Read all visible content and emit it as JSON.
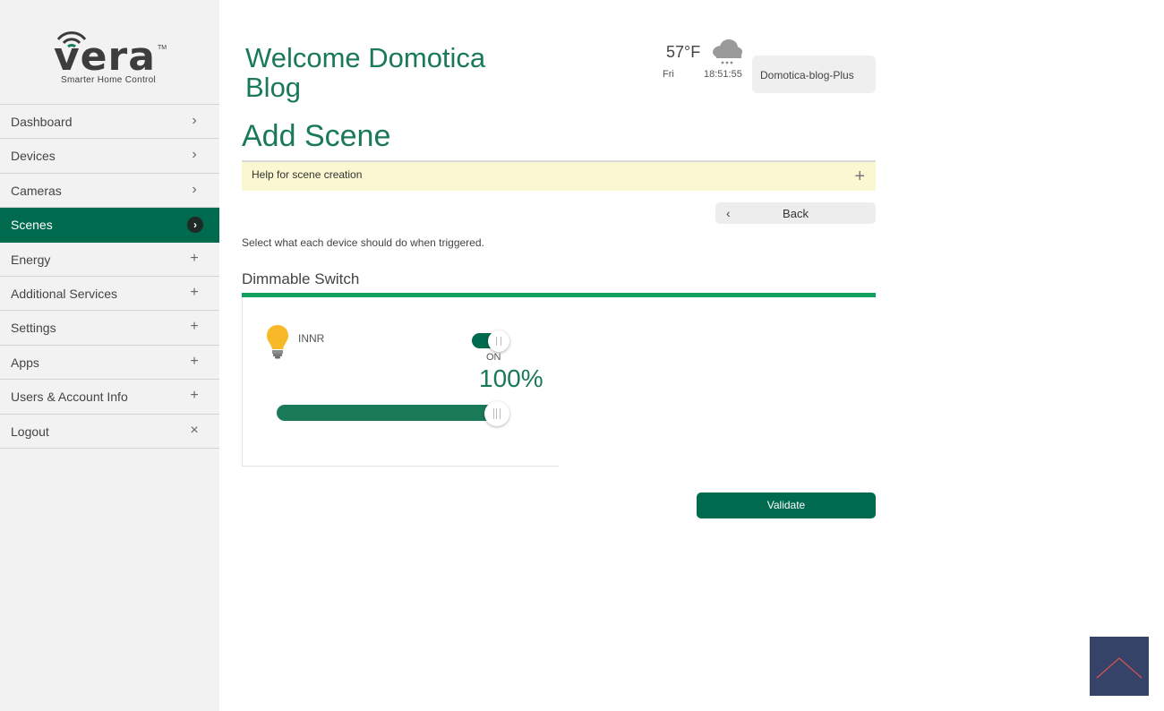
{
  "brand": {
    "logo_text": "vera",
    "tagline": "Smarter Home Control",
    "trademark": "TM"
  },
  "sidebar": {
    "items": [
      {
        "label": "Dashboard",
        "icon": "chevron-right-icon",
        "glyph": "›",
        "active": false
      },
      {
        "label": "Devices",
        "icon": "chevron-right-icon",
        "glyph": "›",
        "active": false
      },
      {
        "label": "Cameras",
        "icon": "chevron-right-icon",
        "glyph": "›",
        "active": false
      },
      {
        "label": "Scenes",
        "icon": "chevron-right-circle-icon",
        "glyph": "›",
        "active": true
      },
      {
        "label": "Energy",
        "icon": "plus-icon",
        "glyph": "+",
        "active": false
      },
      {
        "label": "Additional Services",
        "icon": "plus-icon",
        "glyph": "+",
        "active": false
      },
      {
        "label": "Settings",
        "icon": "plus-icon",
        "glyph": "+",
        "active": false
      },
      {
        "label": "Apps",
        "icon": "plus-icon",
        "glyph": "+",
        "active": false
      },
      {
        "label": "Users & Account Info",
        "icon": "plus-icon",
        "glyph": "+",
        "active": false
      },
      {
        "label": "Logout",
        "icon": "close-icon",
        "glyph": "×",
        "active": false
      }
    ]
  },
  "header": {
    "welcome": "Welcome Domotica Blog",
    "weather": {
      "temperature": "57°F",
      "day": "Fri",
      "time": "18:51:55",
      "icon": "cloud-snow-icon"
    },
    "account_name": "Domotica-blog-Plus"
  },
  "main": {
    "title": "Add Scene",
    "help_label": "Help for scene creation",
    "back_label": "Back",
    "instructions": "Select what each device should do when triggered.",
    "section_title": "Dimmable Switch",
    "device": {
      "name": "INNR",
      "icon": "lightbulb-icon",
      "toggle_state": "ON",
      "level_percent": 100,
      "level_text": "100%"
    },
    "validate_label": "Validate"
  },
  "colors": {
    "accent": "#006a4e",
    "heading_green": "#1a7a57",
    "rule_green": "#13a05e",
    "help_bg": "#fbf7d0",
    "bulb_yellow": "#f7b928",
    "scroll_button": "#364369"
  }
}
